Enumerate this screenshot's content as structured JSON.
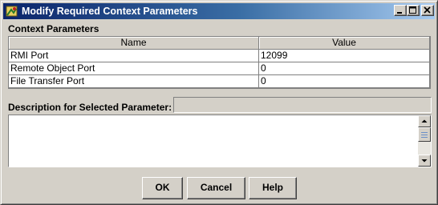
{
  "window": {
    "title": "Modify Required Context Parameters",
    "colors": {
      "titlebar_start": "#0a246a",
      "titlebar_end": "#a6caf0",
      "face": "#d4d0c8"
    }
  },
  "context_parameters": {
    "label": "Context Parameters",
    "columns": [
      "Name",
      "Value"
    ],
    "rows": [
      {
        "name": "RMI Port",
        "value": "12099"
      },
      {
        "name": "Remote Object Port",
        "value": "0"
      },
      {
        "name": "File Transfer Port",
        "value": "0"
      }
    ]
  },
  "description": {
    "label": "Description for Selected Parameter:",
    "field_value": "",
    "text": ""
  },
  "buttons": {
    "ok": "OK",
    "cancel": "Cancel",
    "help": "Help"
  }
}
